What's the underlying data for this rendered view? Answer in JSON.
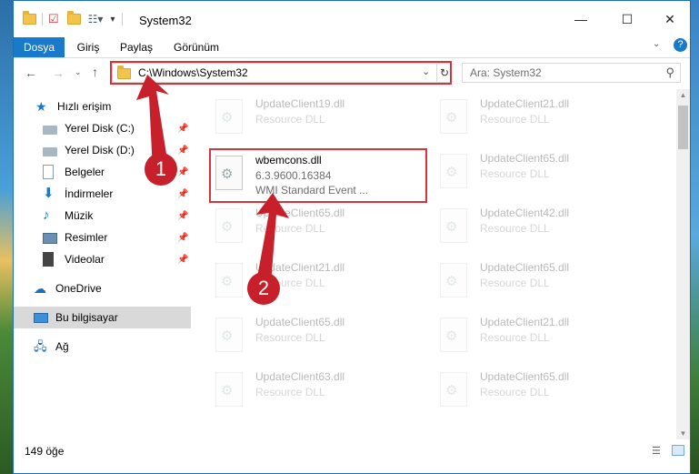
{
  "window": {
    "title": "System32",
    "controls": {
      "minimize": "—",
      "maximize": "☐",
      "close": "✕"
    }
  },
  "ribbon": {
    "tabs": [
      {
        "label": "Dosya",
        "active": true
      },
      {
        "label": "Giriş",
        "active": false
      },
      {
        "label": "Paylaş",
        "active": false
      },
      {
        "label": "Görünüm",
        "active": false
      }
    ],
    "help": "?"
  },
  "address": {
    "path": "C:\\Windows\\System32",
    "search_placeholder": "Ara: System32"
  },
  "nav": {
    "items": [
      {
        "label": "Hızlı erişim",
        "icon": "star-icon",
        "pinned": false
      },
      {
        "label": "Yerel Disk (C:)",
        "icon": "drive-icon",
        "pinned": true
      },
      {
        "label": "Yerel Disk (D:)",
        "icon": "drive-icon",
        "pinned": true
      },
      {
        "label": "Belgeler",
        "icon": "documents-icon",
        "pinned": true
      },
      {
        "label": "İndirmeler",
        "icon": "download-icon",
        "pinned": true
      },
      {
        "label": "Müzik",
        "icon": "music-icon",
        "pinned": true
      },
      {
        "label": "Resimler",
        "icon": "pictures-icon",
        "pinned": true
      },
      {
        "label": "Videolar",
        "icon": "video-icon",
        "pinned": true
      },
      {
        "label": "OneDrive",
        "icon": "cloud-icon",
        "pinned": false
      },
      {
        "label": "Bu bilgisayar",
        "icon": "computer-icon",
        "pinned": false,
        "selected": true
      },
      {
        "label": "Ağ",
        "icon": "network-icon",
        "pinned": false
      }
    ]
  },
  "files": [
    {
      "name": "UpdateClient19.dll",
      "line2": "Resource DLL",
      "faded": true
    },
    {
      "name": "UpdateClient21.dll",
      "line2": "Resource DLL",
      "faded": true
    },
    {
      "name": "wbemcons.dll",
      "line2": "6.3.9600.16384",
      "line3": "WMI Standard Event ...",
      "faded": false
    },
    {
      "name": "UpdateClient65.dll",
      "line2": "Resource DLL",
      "faded": true
    },
    {
      "name": "UpdateClient65.dll",
      "line2": "Resource DLL",
      "faded": true
    },
    {
      "name": "UpdateClient42.dll",
      "line2": "Resource DLL",
      "faded": true
    },
    {
      "name": "UpdateClient21.dll",
      "line2": "Resource DLL",
      "faded": true
    },
    {
      "name": "UpdateClient65.dll",
      "line2": "Resource DLL",
      "faded": true
    },
    {
      "name": "UpdateClient65.dll",
      "line2": "Resource DLL",
      "faded": true
    },
    {
      "name": "UpdateClient21.dll",
      "line2": "Resource DLL",
      "faded": true
    },
    {
      "name": "UpdateClient63.dll",
      "line2": "Resource DLL",
      "faded": true
    },
    {
      "name": "UpdateClient65.dll",
      "line2": "Resource DLL",
      "faded": true
    }
  ],
  "status": {
    "count": "149 öğe"
  },
  "annotations": {
    "badge1": "1",
    "badge2": "2"
  },
  "colors": {
    "accent": "#1979ca",
    "highlight": "#d6343c"
  }
}
